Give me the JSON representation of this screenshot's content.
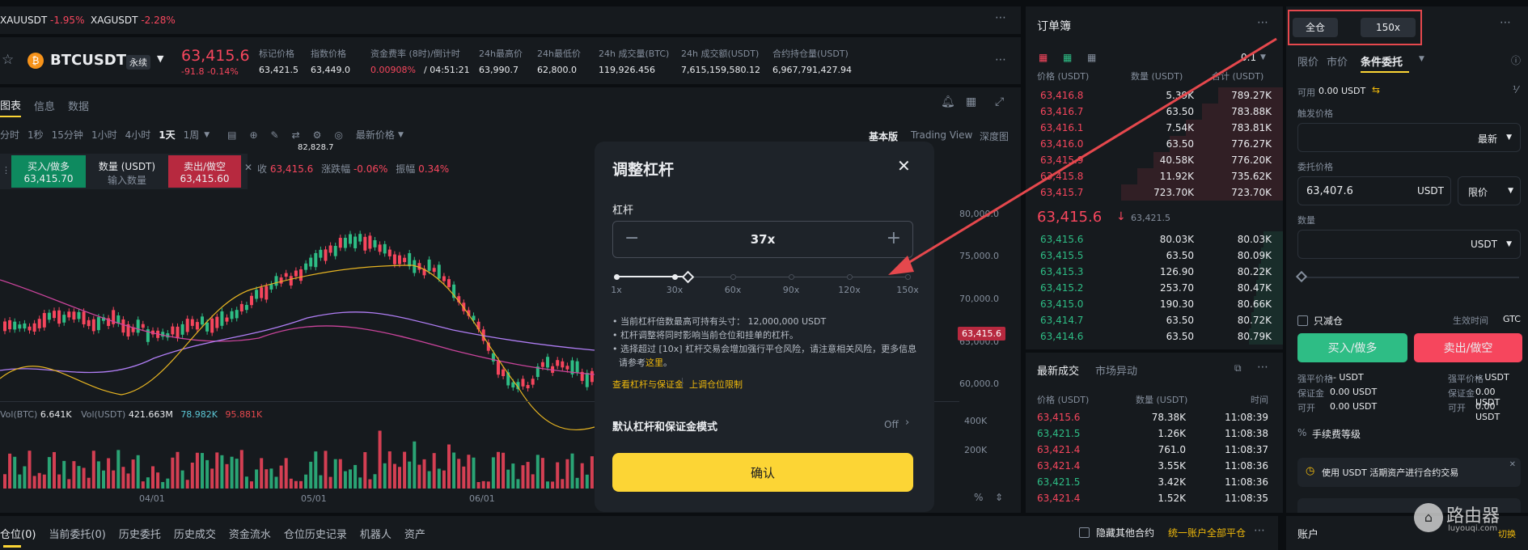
{
  "tickers": [
    {
      "sym": "XAUUSDT",
      "chg": "-1.95%"
    },
    {
      "sym": "XAGUSDT",
      "chg": "-2.28%"
    }
  ],
  "symbol": {
    "name": "BTCUSDT",
    "badge": "永续",
    "price": "63,415.6",
    "chg": "-91.8 -0.14%"
  },
  "stats": [
    {
      "l": "标记价格",
      "v": "63,421.5"
    },
    {
      "l": "指数价格",
      "v": "63,449.0"
    },
    {
      "l": "资金费率 (8时)/倒计时",
      "v": "0.00908%",
      "v2": "/ 04:51:21"
    },
    {
      "l": "24h最高价",
      "v": "63,990.7"
    },
    {
      "l": "24h最低价",
      "v": "62,800.0"
    },
    {
      "l": "24h 成交量(BTC)",
      "v": "119,926.456"
    },
    {
      "l": "24h 成交额(USDT)",
      "v": "7,615,159,580.12"
    },
    {
      "l": "合约持仓量(USDT)",
      "v": "6,967,791,427.94"
    }
  ],
  "chart_tabs": [
    "图表",
    "信息",
    "数据"
  ],
  "intervals": [
    "分时",
    "1秒",
    "15分钟",
    "1小时",
    "4小时",
    "1天",
    "1周"
  ],
  "latest_price_label": "最新价格",
  "views": [
    "基本版",
    "Trading View",
    "深度图"
  ],
  "quick": {
    "buy": "买入/做多",
    "buy_price": "63,415.70",
    "qty": "数量 (USDT)",
    "qty_ph": "输入数量",
    "sell": "卖出/做空",
    "sell_price": "63,415.60"
  },
  "ohlc": {
    "close_l": "收",
    "close": "63,415.6",
    "chg_l": "涨跌幅",
    "chg": "-0.06%",
    "amp_l": "振幅",
    "amp": "0.34%"
  },
  "chart_high": "82,828.7",
  "y_axis": [
    "80,000.0",
    "75,000.0",
    "70,000.0",
    "65,000.0",
    "60,000.0"
  ],
  "price_tag": "63,415.6",
  "vol": {
    "l1": "Vol(BTC)",
    "v1": "6.641K",
    "l2": "Vol(USDT)",
    "v2": "421.663M",
    "v3": "78.982K",
    "v4": "95.881K"
  },
  "vol_axis": [
    "400K",
    "200K"
  ],
  "x_axis": [
    "04/01",
    "05/01",
    "06/01"
  ],
  "bottom_tabs": [
    "仓位(0)",
    "当前委托(0)",
    "历史委托",
    "历史成交",
    "资金流水",
    "仓位历史记录",
    "机器人",
    "资产"
  ],
  "hide_pairs": "隐藏其他合约",
  "close_all": "统一账户全部平仓",
  "orderbook": {
    "title": "订单簿",
    "precision": "0.1",
    "h_price": "价格 (USDT)",
    "h_qty": "数量 (USDT)",
    "h_total": "合计 (USDT)",
    "asks": [
      {
        "p": "63,416.8",
        "q": "5.39K",
        "t": "789.27K"
      },
      {
        "p": "63,416.7",
        "q": "63.50",
        "t": "783.88K"
      },
      {
        "p": "63,416.1",
        "q": "7.54K",
        "t": "783.81K"
      },
      {
        "p": "63,416.0",
        "q": "63.50",
        "t": "776.27K"
      },
      {
        "p": "63,415.9",
        "q": "40.58K",
        "t": "776.20K"
      },
      {
        "p": "63,415.8",
        "q": "11.92K",
        "t": "735.62K"
      },
      {
        "p": "63,415.7",
        "q": "723.70K",
        "t": "723.70K"
      }
    ],
    "mid": "63,415.6",
    "mid_arrow": "↓",
    "mid_mark": "63,421.5",
    "bids": [
      {
        "p": "63,415.6",
        "q": "80.03K",
        "t": "80.03K"
      },
      {
        "p": "63,415.5",
        "q": "63.50",
        "t": "80.09K"
      },
      {
        "p": "63,415.3",
        "q": "126.90",
        "t": "80.22K"
      },
      {
        "p": "63,415.2",
        "q": "253.70",
        "t": "80.47K"
      },
      {
        "p": "63,415.0",
        "q": "190.30",
        "p2": "",
        "t": "80.66K"
      },
      {
        "p": "63,414.7",
        "q": "63.50",
        "t": "80.72K"
      },
      {
        "p": "63,414.6",
        "q": "63.50",
        "t": "80.79K"
      }
    ]
  },
  "trades": {
    "tab1": "最新成交",
    "tab2": "市场异动",
    "h_price": "价格 (USDT)",
    "h_qty": "数量 (USDT)",
    "h_time": "时间",
    "rows": [
      {
        "p": "63,415.6",
        "q": "78.38K",
        "t": "11:08:39",
        "c": "red"
      },
      {
        "p": "63,421.5",
        "q": "1.26K",
        "t": "11:08:38",
        "c": "green"
      },
      {
        "p": "63,421.4",
        "q": "761.0",
        "t": "11:08:37",
        "c": "red"
      },
      {
        "p": "63,421.4",
        "q": "3.55K",
        "t": "11:08:36",
        "c": "red"
      },
      {
        "p": "63,421.5",
        "q": "3.42K",
        "t": "11:08:36",
        "c": "green"
      },
      {
        "p": "63,421.4",
        "q": "1.52K",
        "t": "11:08:35",
        "c": "red"
      }
    ]
  },
  "order": {
    "margin_mode": "全仓",
    "leverage": "150x",
    "types": [
      "限价",
      "市价",
      "条件委托"
    ],
    "avail_l": "可用",
    "avail": "0.00 USDT",
    "trigger_l": "触发价格",
    "trigger_sel": "最新",
    "price_l": "委托价格",
    "price_v": "63,407.6",
    "price_unit": "USDT",
    "price_type": "限价",
    "qty_l": "数量",
    "qty_unit": "USDT",
    "reduce": "只减仓",
    "tif_l": "生效时间",
    "tif": "GTC",
    "buy": "买入/做多",
    "sell": "卖出/做空",
    "info": [
      {
        "l": "强平价格",
        "v": "-- USDT"
      },
      {
        "l": "保证金",
        "v": "0.00 USDT"
      },
      {
        "l": "可开",
        "v": "0.00 USDT"
      }
    ],
    "fee": "手续费等级",
    "promo": "使用 USDT 活期资产进行合约交易",
    "account": "账户",
    "switch": "切换"
  },
  "modal": {
    "title": "调整杠杆",
    "lev_label": "杠杆",
    "lev_value": "37x",
    "lev_fraction": 0.245,
    "ticks": [
      "1x",
      "30x",
      "60x",
      "90x",
      "120x",
      "150x"
    ],
    "notes": [
      "当前杠杆倍数最高可持有头寸：  12,000,000 USDT",
      "杠杆调整将同时影响当前仓位和挂单的杠杆。",
      "选择超过 [10x] 杠杆交易会增加强行平仓风险，请注意相关风险，更多信息请参考"
    ],
    "here": "这里",
    "link1": "查看杠杆与保证金",
    "link2": "上调仓位限制",
    "default_mode": "默认杠杆和保证金模式",
    "off": "Off",
    "confirm": "确认"
  },
  "watermark": {
    "name": "路由器",
    "url": "luyouqi.com"
  },
  "colors": {
    "up": "#2ebd85",
    "down": "#f6465d",
    "accent": "#fcd535",
    "annot": "#e5484d"
  }
}
